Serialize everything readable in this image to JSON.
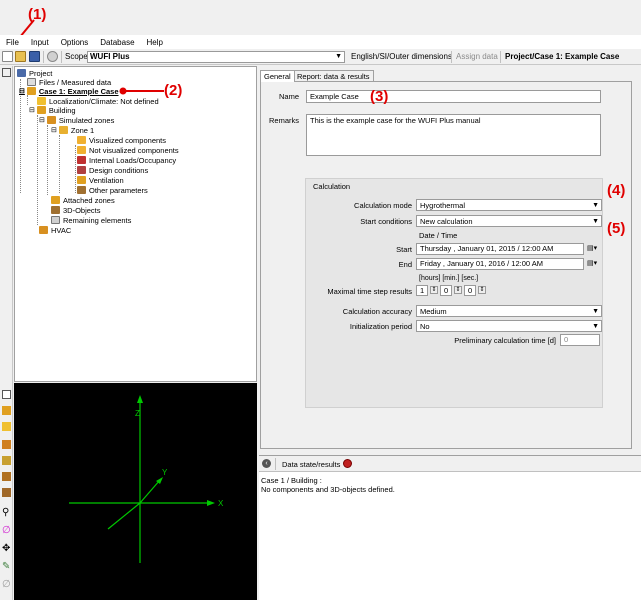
{
  "annotations": [
    "(1)",
    "(2)",
    "(3)",
    "(4)",
    "(5)"
  ],
  "menu": [
    "File",
    "Input",
    "Options",
    "Database",
    "Help"
  ],
  "toolbar": {
    "scope_label": "Scope",
    "scope_value": "WUFI Plus",
    "dimensions": "English/SI/Outer dimensions",
    "assign": "Assign data",
    "breadcrumb": "Project/Case 1: Example Case"
  },
  "tree": {
    "project": "Project",
    "files": "Files / Measured data",
    "case": "Case 1: Example Case",
    "localization": "Localization/Climate: Not defined",
    "building": "Building",
    "simulated_zones": "Simulated zones",
    "zone": "Zone 1",
    "visualized": "Visualized components",
    "not_visualized": "Not visualized components",
    "internal_loads": "Internal Loads/Occupancy",
    "design": "Design conditions",
    "ventilation": "Ventilation",
    "other": "Other parameters",
    "attached": "Attached zones",
    "objects3d": "3D-Objects",
    "remaining": "Remaining elements",
    "hvac": "HVAC"
  },
  "axes": {
    "x": "X",
    "y": "Y",
    "z": "Z"
  },
  "tabs": {
    "general": "General",
    "report": "Report: data & results"
  },
  "form": {
    "name_label": "Name",
    "name_value": "Example Case",
    "remarks_label": "Remarks",
    "remarks_value": "This is the example case for the WUFI Plus manual",
    "calc_title": "Calculation",
    "calc_mode_label": "Calculation mode",
    "calc_mode_value": "Hygrothermal",
    "start_cond_label": "Start conditions",
    "start_cond_value": "New calculation",
    "datetime_header": "Date / Time",
    "start_label": "Start",
    "start_value": "Thursday  ,  January  01, 2015  /  12:00 AM",
    "end_label": "End",
    "end_value": "Friday  ,  January  01, 2016  /  12:00 AM",
    "time_units": "[hours]   [min.]   [sec.]",
    "max_step_label": "Maximal time step results",
    "step_hours": "1",
    "step_min": "0",
    "step_sec": "0",
    "accuracy_label": "Calculation accuracy",
    "accuracy_value": "Medium",
    "init_label": "Initialization period",
    "init_value": "No",
    "prelim_label": "Preliminary calculation time  [d]",
    "prelim_value": "0"
  },
  "bottom": {
    "title": "Data state/results",
    "path": "Case 1 / Building :",
    "message": "No components and 3D-objects defined."
  }
}
